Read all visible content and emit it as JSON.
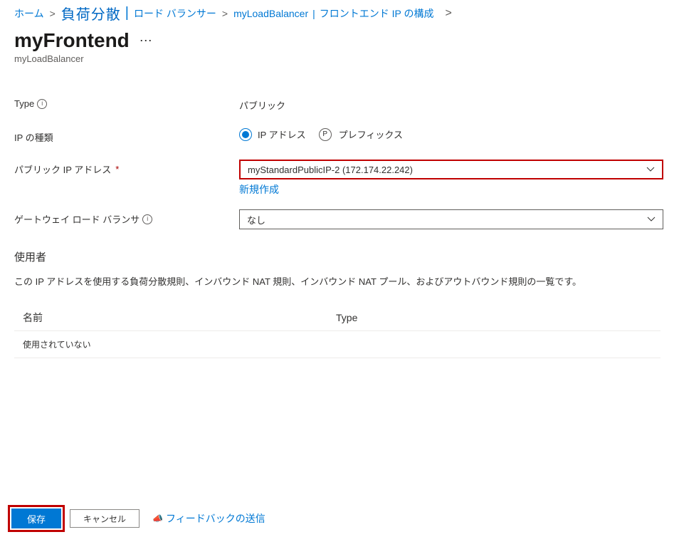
{
  "breadcrumb": {
    "home": "ホーム",
    "loadbalancing": "負荷分散",
    "loadbalancers": "ロード バランサー",
    "resource": "myLoadBalancer",
    "blade": "フロントエンド IP の構成"
  },
  "header": {
    "title": "myFrontend",
    "subtitle": "myLoadBalancer"
  },
  "form": {
    "typeLabel": "Type",
    "typeValue": "パブリック",
    "ipKindLabel": "IP の種類",
    "ipAddressOption": "IP アドレス",
    "previewBadge": "P",
    "prefixOption": "プレフィックス",
    "publicIpLabel": "パブリック IP アドレス",
    "publicIpValue": "myStandardPublicIP-2 (172.174.22.242)",
    "createNew": "新規作成",
    "gatewayLbLabel": "ゲートウェイ ロード バランサ",
    "gatewayLbValue": "なし"
  },
  "usedBy": {
    "title": "使用者",
    "description": "この IP アドレスを使用する負荷分散規則、インバウンド NAT 規則、インバウンド NAT プール、およびアウトバウンド規則の一覧です。",
    "colName": "名前",
    "colType": "Type",
    "emptyRow": "使用されていない"
  },
  "footer": {
    "save": "保存",
    "cancel": "キャンセル",
    "feedback": "フィードバックの送信"
  }
}
